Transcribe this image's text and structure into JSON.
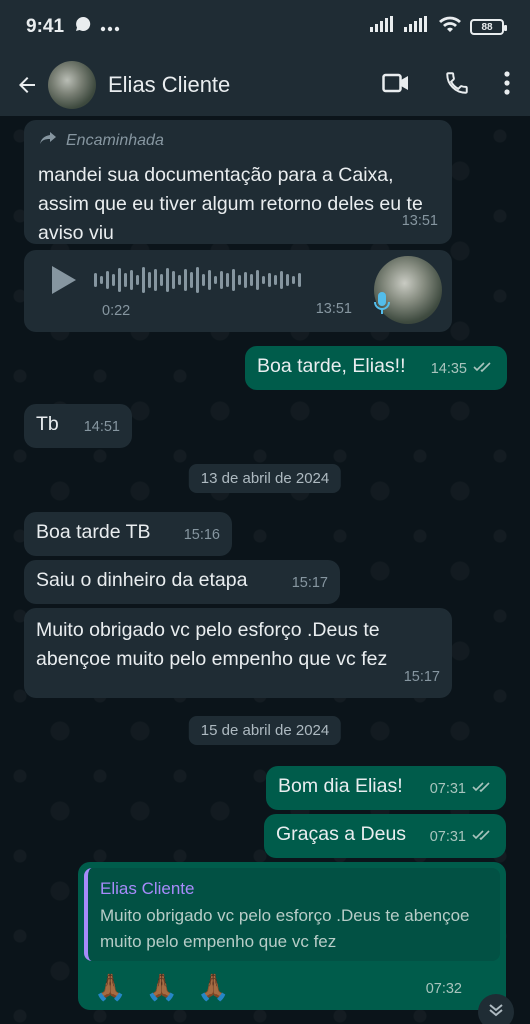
{
  "status": {
    "time": "9:41",
    "battery": "88"
  },
  "header": {
    "contact_name": "Elias Cliente"
  },
  "messages": {
    "m1": {
      "forwarded_label": "Encaminhada",
      "text": "mandei sua documentação para a Caixa, assim que eu tiver algum retorno deles eu te aviso viu",
      "time": "13:51"
    },
    "m2": {
      "duration": "0:22",
      "time": "13:51"
    },
    "m3": {
      "text": "Boa tarde, Elias!!",
      "time": "14:35"
    },
    "m4": {
      "text": "Tb",
      "time": "14:51"
    },
    "date1": "13 de abril de 2024",
    "m5": {
      "text": "Boa tarde TB",
      "time": "15:16"
    },
    "m6": {
      "text": "Saiu o dinheiro da etapa",
      "time": "15:17"
    },
    "m7": {
      "text": "Muito obrigado vc pelo esforço .Deus te abençoe muito pelo empenho que vc fez",
      "time": "15:17"
    },
    "date2": "15 de abril de 2024",
    "m8": {
      "text": "Bom dia Elias!",
      "time": "07:31"
    },
    "m9": {
      "text": "Graças a Deus",
      "time": "07:31"
    },
    "m10": {
      "quote_name": "Elias Cliente",
      "quote_text": "Muito obrigado vc pelo esforço .Deus te abençoe muito pelo empenho que vc fez",
      "text": "🙏🏾 🙏🏾 🙏🏾",
      "time": "07:32"
    }
  },
  "colors": {
    "incoming": "#1f2c34",
    "outgoing": "#005c4b",
    "background": "#0b141a",
    "read_tick": "#8696a0"
  }
}
